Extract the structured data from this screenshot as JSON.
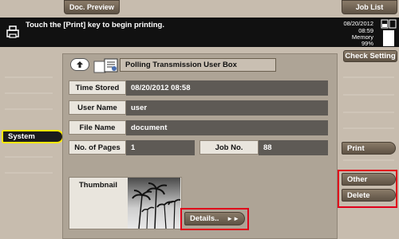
{
  "header": {
    "doc_preview_tab": "Doc. Preview",
    "job_list_tab": "Job List",
    "message": "Touch the [Print] key to begin printing.",
    "date": "08/20/2012",
    "time": "08:59",
    "memory_label": "Memory",
    "memory_value": "99%",
    "check_setting_button": "Check Setting"
  },
  "left_menu": {
    "system_label": "System"
  },
  "panel": {
    "box_title": "Polling Transmission User Box",
    "fields": {
      "time_stored_label": "Time Stored",
      "time_stored_value": "08/20/2012 08:58",
      "user_name_label": "User Name",
      "user_name_value": "user",
      "file_name_label": "File Name",
      "file_name_value": "document",
      "pages_label": "No. of Pages",
      "pages_value": "1",
      "job_no_label": "Job No.",
      "job_no_value": "88",
      "thumbnail_label": "Thumbnail"
    },
    "details_button": "Details.."
  },
  "right_menu": {
    "print_button": "Print",
    "other_button": "Other",
    "delete_button": "Delete"
  },
  "colors": {
    "background": "#c7bcae",
    "message_bar": "#111111",
    "value_field": "#5e5a55",
    "highlight": "#e0001a",
    "system_pill": "#ffe800"
  }
}
